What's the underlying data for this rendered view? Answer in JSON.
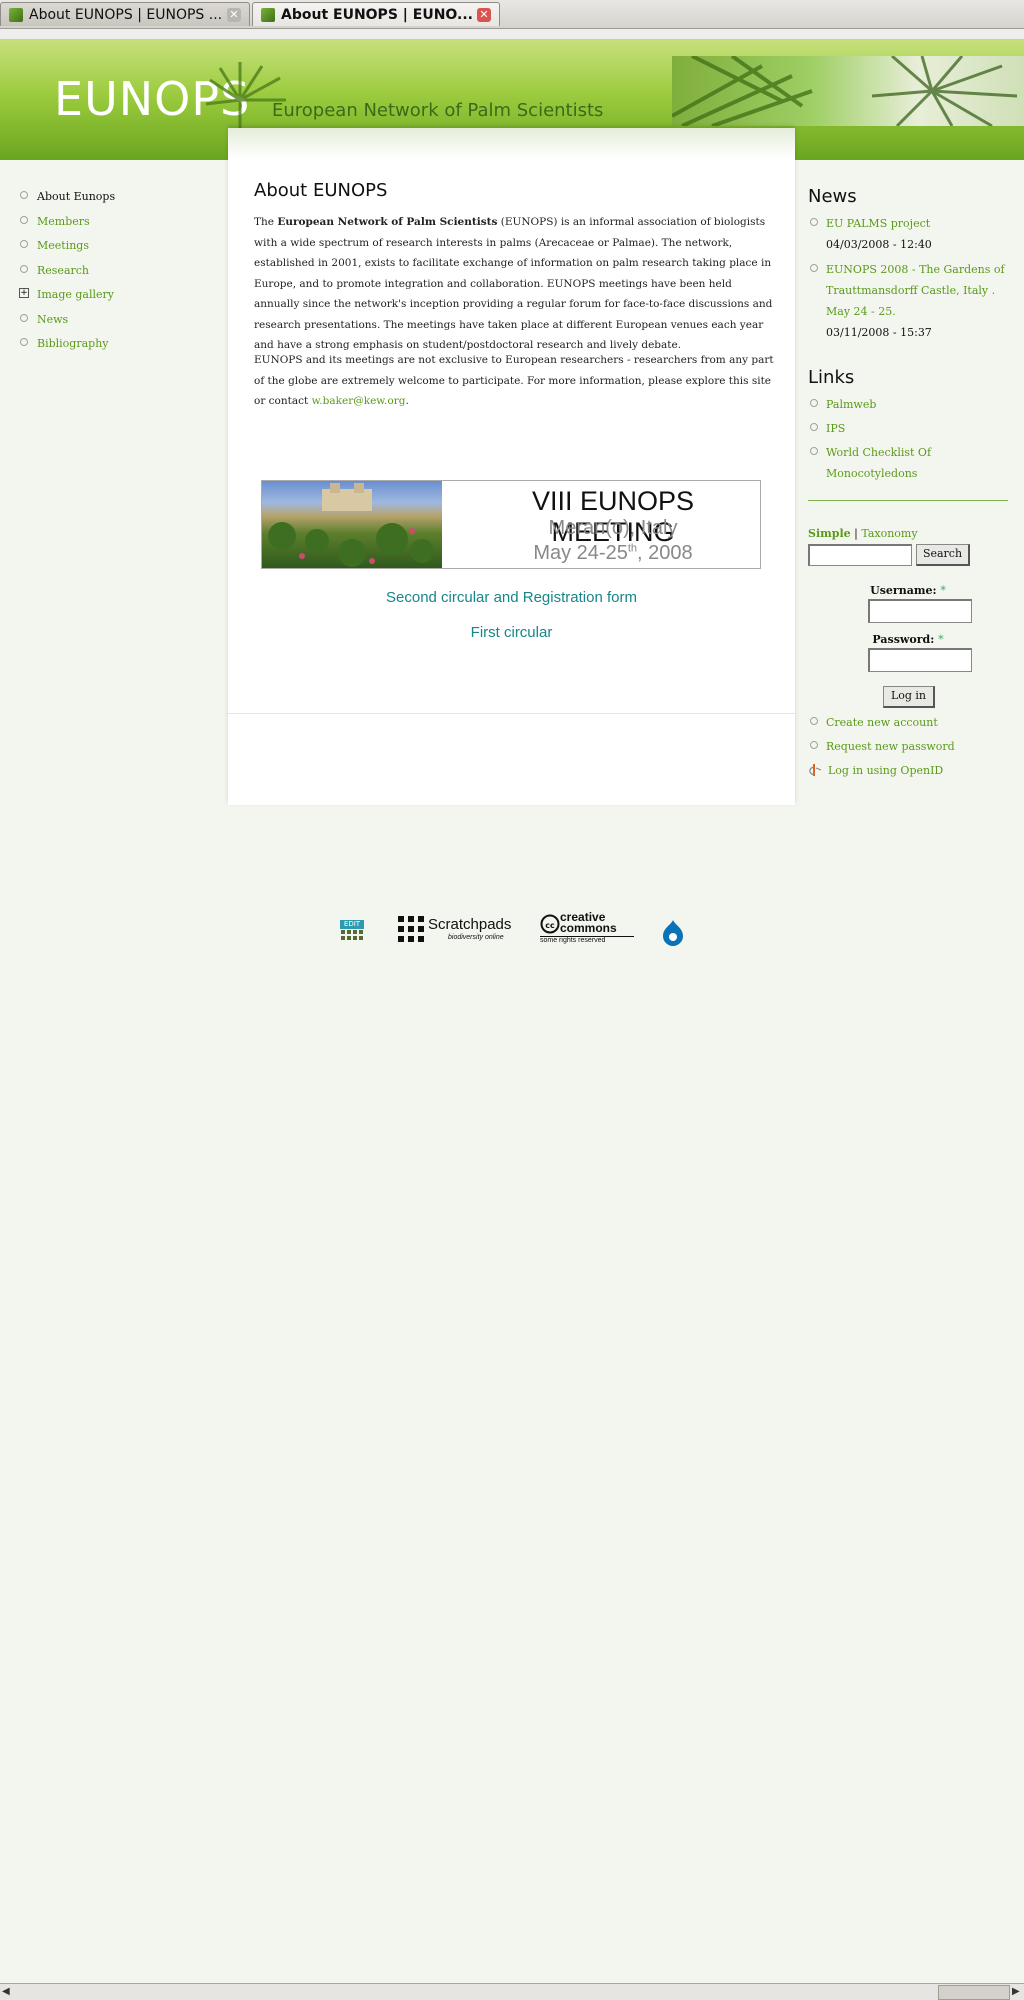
{
  "browser": {
    "tabs": [
      {
        "label": "About EUNOPS | EUNOPS ...",
        "active": false
      },
      {
        "label": "About EUNOPS | EUNO...",
        "active": true
      }
    ]
  },
  "header": {
    "logo": "EUNOPS",
    "tagline": "European Network of Palm Scientists"
  },
  "sidebar": {
    "items": [
      {
        "label": "About Eunops",
        "active": true
      },
      {
        "label": "Members"
      },
      {
        "label": "Meetings"
      },
      {
        "label": "Research"
      },
      {
        "label": "Image gallery",
        "expandable": true
      },
      {
        "label": "News"
      },
      {
        "label": "Bibliography"
      }
    ]
  },
  "main": {
    "title": "About EUNOPS",
    "para1_prefix": "The ",
    "para1_bold": "European Network of Palm Scientists",
    "para1_rest": " (EUNOPS) is an informal association of biologists with a wide spectrum of research interests in palms (Arecaceae or Palmae). The network, established in 2001, exists to facilitate exchange of information on palm research taking place in Europe, and to promote integration and collaboration. EUNOPS meetings have been held annually since the network's inception providing a regular forum for face-to-face discussions and research presentations. The meetings have taken place at different European venues each year and have a strong emphasis on student/postdoctoral research and lively debate.",
    "para2_text": "EUNOPS and its meetings are not exclusive to European researchers - researchers from any part of the globe are extremely welcome to participate. For more information, please explore this site or contact ",
    "para2_link": "w.baker@kew.org",
    "para2_end": ".",
    "banner": {
      "line1": "VIII EUNOPS MEETING",
      "line2": "Meran(o), Italy",
      "line3_prefix": "May 24-25",
      "line3_sup": "th",
      "line3_suffix": ", 2008"
    },
    "link_second": "Second circular and Registration form",
    "link_first": "First circular"
  },
  "right": {
    "news_title": "News",
    "news": [
      {
        "title": "EU PALMS project",
        "date": "04/03/2008 - 12:40"
      },
      {
        "title": "EUNOPS 2008 - The Gardens of Trauttmansdorff Castle, Italy . May 24 - 25.",
        "date": "03/11/2008 - 15:37"
      }
    ],
    "links_title": "Links",
    "links": [
      "Palmweb",
      "IPS",
      "World Checklist Of Monocotyledons"
    ],
    "search": {
      "tab_simple": "Simple",
      "tab_sep": "|",
      "tab_taxonomy": "Taxonomy",
      "value": "",
      "button": "Search"
    },
    "login": {
      "username_label": "Username:",
      "password_label": "Password:",
      "required_mark": "*",
      "username_value": "",
      "password_value": "",
      "button": "Log in",
      "links": [
        "Create new account",
        "Request new password",
        "Log in using OpenID"
      ]
    }
  },
  "footer": {
    "logos": [
      {
        "name": "edit-logo",
        "text": "EDIT"
      },
      {
        "name": "scratchpads-logo",
        "text": "Scratchpads",
        "sub": "biodiversity online"
      },
      {
        "name": "creative-commons-logo",
        "text": "creative commons",
        "sub": "some rights reserved"
      },
      {
        "name": "drupal-logo",
        "text": ""
      }
    ]
  }
}
